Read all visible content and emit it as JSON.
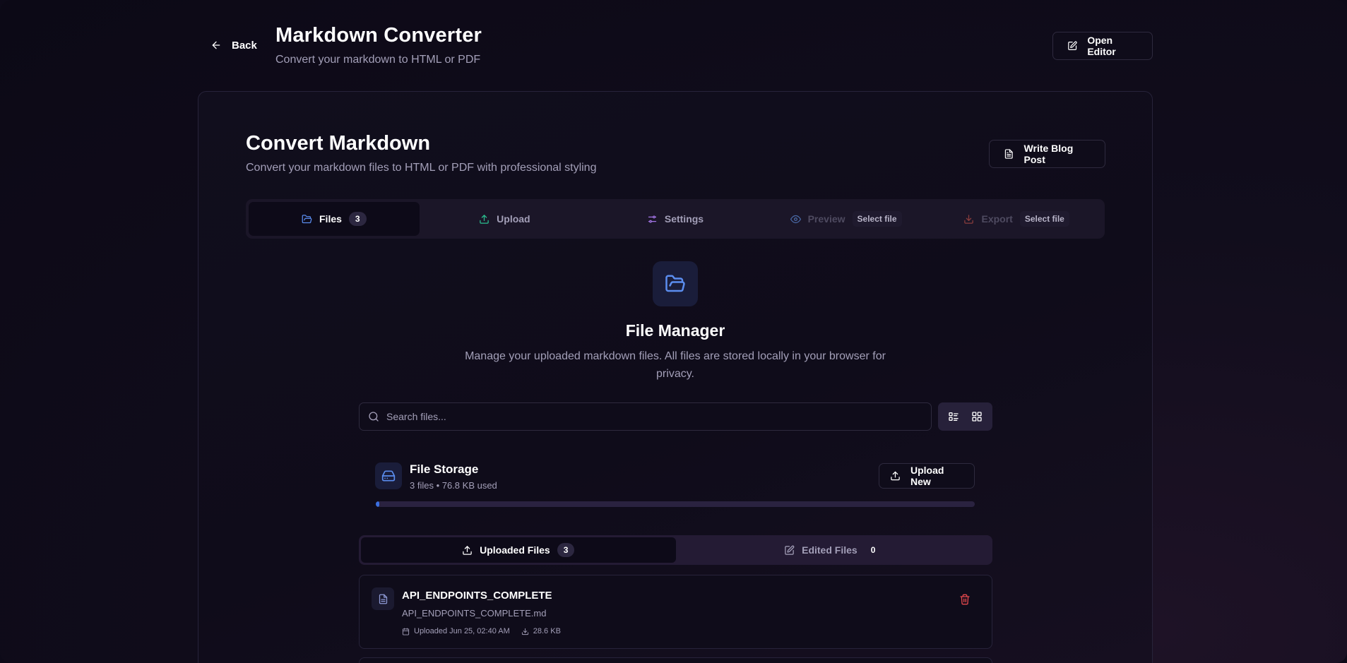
{
  "header": {
    "back_label": "Back",
    "title": "Markdown Converter",
    "subtitle": "Convert your markdown to HTML or PDF",
    "open_editor_label": "Open Editor"
  },
  "card": {
    "title": "Convert Markdown",
    "subtitle": "Convert your markdown files to HTML or PDF with professional styling",
    "write_blog_label": "Write Blog Post"
  },
  "tabs": [
    {
      "label": "Files",
      "badge": "3"
    },
    {
      "label": "Upload"
    },
    {
      "label": "Settings"
    },
    {
      "label": "Preview",
      "pill": "Select file"
    },
    {
      "label": "Export",
      "pill": "Select file"
    }
  ],
  "file_manager": {
    "title": "File Manager",
    "description": "Manage your uploaded markdown files. All files are stored locally in your browser for privacy."
  },
  "search": {
    "placeholder": "Search files...",
    "value": ""
  },
  "storage": {
    "title": "File Storage",
    "meta": "3 files • 76.8 KB used",
    "upload_new_label": "Upload New",
    "usage_fraction": 0.006
  },
  "subtabs": [
    {
      "label": "Uploaded Files",
      "count": "3"
    },
    {
      "label": "Edited Files",
      "count": "0"
    }
  ],
  "files": [
    {
      "name": "API_ENDPOINTS_COMPLETE",
      "filename": "API_ENDPOINTS_COMPLETE.md",
      "uploaded": "Uploaded Jun 25, 02:40 AM",
      "size": "28.6 KB"
    }
  ],
  "colors": {
    "background": "#0d0a18",
    "accent_blue": "#5b8def",
    "upload_green": "#2bbf8f",
    "settings_purple": "#a475e8",
    "preview_blue": "#4a6aa8",
    "export_red": "#8a3d3d",
    "danger": "#e5484d"
  },
  "icons": {
    "back": "arrow-left-icon",
    "open_editor": "edit-square-icon",
    "write_blog": "file-text-icon",
    "files_tab": "folder-open-icon",
    "upload_tab": "upload-icon",
    "settings_tab": "sliders-icon",
    "preview_tab": "eye-icon",
    "export_tab": "download-icon",
    "file_manager": "folder-open-icon",
    "search": "search-icon",
    "list_view": "list-view-icon",
    "grid_view": "grid-view-icon",
    "storage": "hard-drive-icon",
    "upload_new": "upload-icon",
    "file": "file-text-icon",
    "calendar": "calendar-icon",
    "download": "download-icon",
    "delete": "trash-icon"
  }
}
